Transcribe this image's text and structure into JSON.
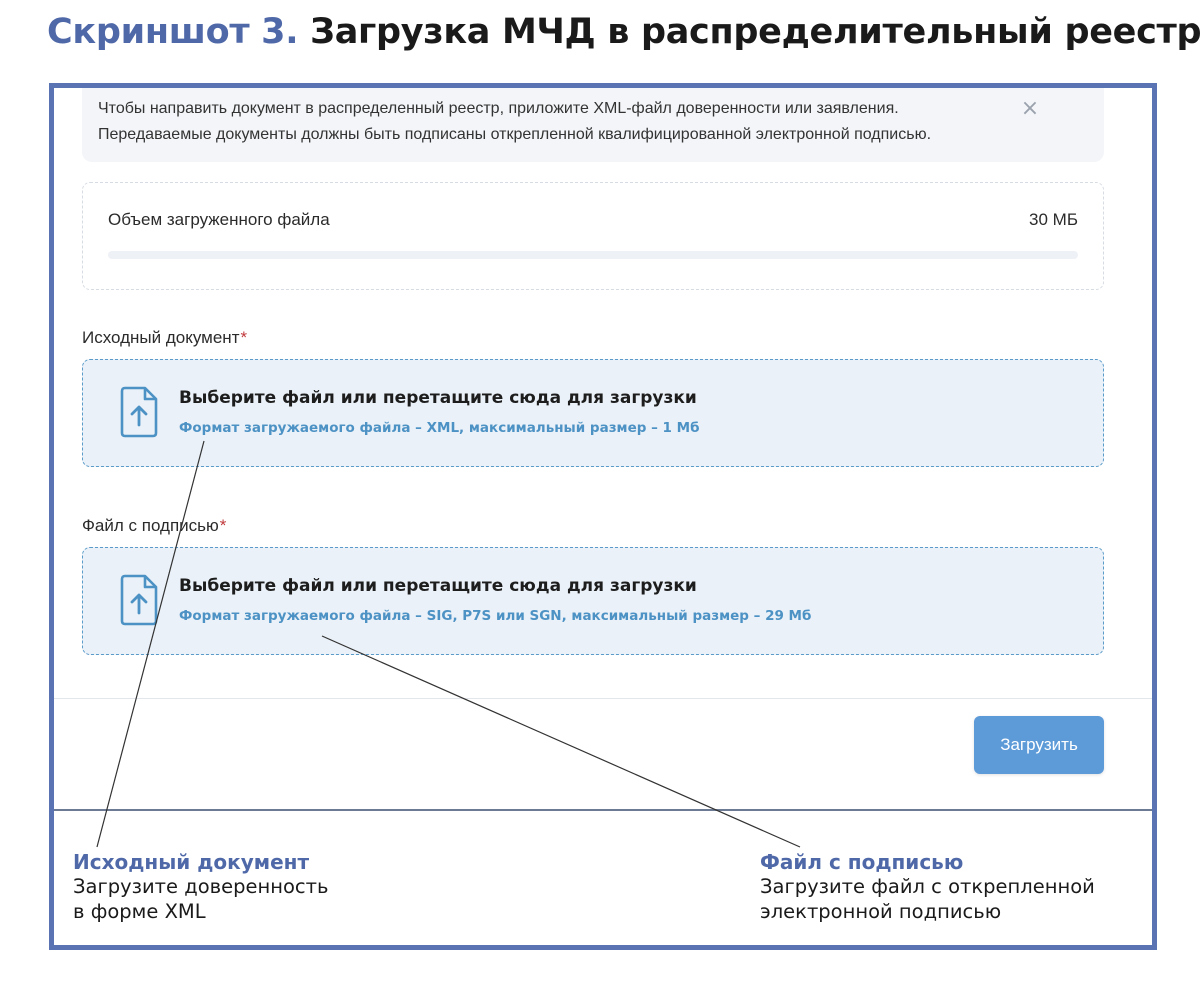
{
  "heading": {
    "lead": "Скриншот 3.",
    "rest": "Загрузка МЧД в распределительный реестр"
  },
  "info": {
    "line1": "Чтобы направить документ в распределенный реестр, приложите XML-файл доверенности или заявления.",
    "line2": "Передаваемые документы должны быть подписаны открепленной квалифицированной электронной подписью.",
    "close_icon": "close-icon"
  },
  "volume": {
    "label": "Объем загруженного файла",
    "value": "30 МБ",
    "fill_fraction": 0
  },
  "source_field": {
    "label": "Исходный документ",
    "required_mark": "*",
    "title": "Выберите файл или перетащите сюда для загрузки",
    "hint": "Формат загружаемого файла – XML, максимальный размер – 1 Мб",
    "icon": "file-upload-icon"
  },
  "signature_field": {
    "label": "Файл с подписью",
    "required_mark": "*",
    "title": "Выберите файл или перетащите сюда для загрузки",
    "hint": "Формат загружаемого файла – SIG, P7S или SGN, максимальный размер – 29 Мб",
    "icon": "file-upload-icon"
  },
  "upload_button": "Загрузить",
  "captions": {
    "left": {
      "title": "Исходный документ",
      "line1": "Загрузите доверенность",
      "line2": "в форме XML"
    },
    "right": {
      "title": "Файл с подписью",
      "line1": "Загрузите файл с открепленной",
      "line2": "электронной подписью"
    }
  },
  "colors": {
    "accent": "#4f68a8",
    "frame": "#5a74b3",
    "dropzone_bg": "#eaf1f8",
    "dropzone_border": "#5b9bc9",
    "hint": "#4d92c4",
    "button": "#5c9ad8",
    "required": "#c0393b"
  }
}
